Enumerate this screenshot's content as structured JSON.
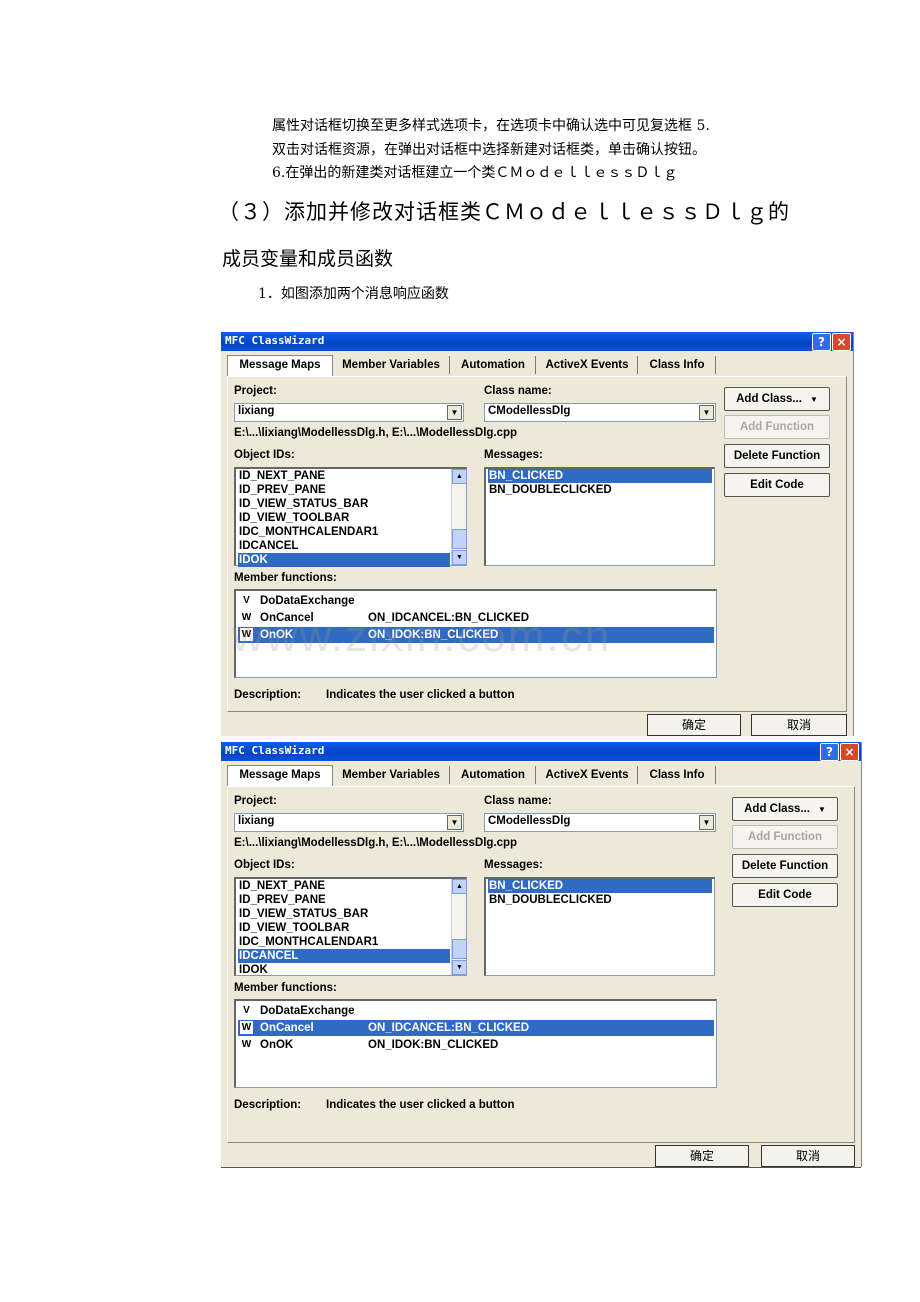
{
  "text": {
    "line1": "属性对话框切换至更多样式选项卡，在选项卡中确认选中可见复选框 5.",
    "line2": "双击对话框资源，在弹出对话框中选择新建对话框类，单击确认按钮。",
    "line3": "6.在弹出的新建类对话框建立一个类ＣＭｏｄｅｌｌｅｓｓＤｌｇ",
    "heading_a": "（３）添加并修改对话框类ＣＭｏｄｅｌｌｅｓｓＤｌｇ的",
    "heading_b": "成员变量和成员函数",
    "item1": "1．如图添加两个消息响应函数"
  },
  "watermark": "www.zixin.com.cn",
  "dialogs": [
    {
      "title": "MFC ClassWizard",
      "help_btn": "?",
      "close_btn": "×",
      "tabs": [
        "Message Maps",
        "Member Variables",
        "Automation",
        "ActiveX Events",
        "Class Info"
      ],
      "project_label": "Project:",
      "project_value": "lixiang",
      "classname_label": "Class name:",
      "classname_value": "CModellessDlg",
      "path": "E:\\...\\lixiang\\ModellessDlg.h, E:\\...\\ModellessDlg.cpp",
      "objectids_label": "Object IDs:",
      "objectids": [
        "ID_NEXT_PANE",
        "ID_PREV_PANE",
        "ID_VIEW_STATUS_BAR",
        "ID_VIEW_TOOLBAR",
        "IDC_MONTHCALENDAR1",
        "IDCANCEL",
        "IDOK"
      ],
      "objectids_selected": 6,
      "messages_label": "Messages:",
      "messages": [
        "BN_CLICKED",
        "BN_DOUBLECLICKED"
      ],
      "messages_selected": 0,
      "memberfns_label": "Member functions:",
      "memberfns": [
        {
          "badge": "V",
          "name": "DoDataExchange",
          "handler": ""
        },
        {
          "badge": "W",
          "name": "OnCancel",
          "handler": "ON_IDCANCEL:BN_CLICKED"
        },
        {
          "badge": "W",
          "name": "OnOK",
          "handler": "ON_IDOK:BN_CLICKED"
        }
      ],
      "memberfns_selected": 2,
      "description_label": "Description:",
      "description": "Indicates the user clicked a button",
      "buttons": {
        "add_class": "Add Class...",
        "add_class_arrow": "▼",
        "add_function": "Add Function",
        "delete_function": "Delete Function",
        "edit_code": "Edit Code"
      },
      "ok": "确定",
      "cancel": "取消"
    },
    {
      "title": "MFC ClassWizard",
      "help_btn": "?",
      "close_btn": "×",
      "tabs": [
        "Message Maps",
        "Member Variables",
        "Automation",
        "ActiveX Events",
        "Class Info"
      ],
      "project_label": "Project:",
      "project_value": "lixiang",
      "classname_label": "Class name:",
      "classname_value": "CModellessDlg",
      "path": "E:\\...\\lixiang\\ModellessDlg.h, E:\\...\\ModellessDlg.cpp",
      "objectids_label": "Object IDs:",
      "objectids": [
        "ID_NEXT_PANE",
        "ID_PREV_PANE",
        "ID_VIEW_STATUS_BAR",
        "ID_VIEW_TOOLBAR",
        "IDC_MONTHCALENDAR1",
        "IDCANCEL",
        "IDOK"
      ],
      "objectids_selected": 5,
      "messages_label": "Messages:",
      "messages": [
        "BN_CLICKED",
        "BN_DOUBLECLICKED"
      ],
      "messages_selected": 0,
      "memberfns_label": "Member functions:",
      "memberfns": [
        {
          "badge": "V",
          "name": "DoDataExchange",
          "handler": ""
        },
        {
          "badge": "W",
          "name": "OnCancel",
          "handler": "ON_IDCANCEL:BN_CLICKED"
        },
        {
          "badge": "W",
          "name": "OnOK",
          "handler": "ON_IDOK:BN_CLICKED"
        }
      ],
      "memberfns_selected": 1,
      "description_label": "Description:",
      "description": "Indicates the user clicked a button",
      "buttons": {
        "add_class": "Add Class...",
        "add_class_arrow": "▼",
        "add_function": "Add Function",
        "delete_function": "Delete Function",
        "edit_code": "Edit Code"
      },
      "ok": "确定",
      "cancel": "取消"
    }
  ]
}
